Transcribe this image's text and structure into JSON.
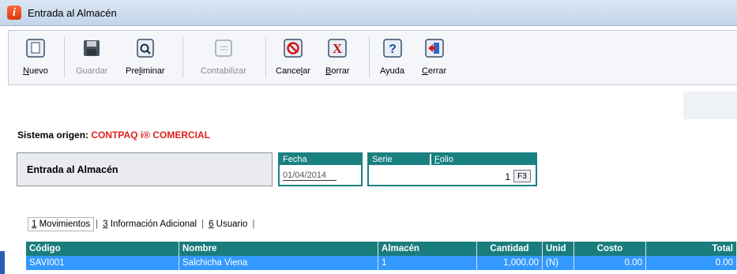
{
  "window": {
    "title": "Entrada al Almacén",
    "app_icon_glyph": "i"
  },
  "toolbar": {
    "nuevo": {
      "pre": "",
      "key": "N",
      "post": "uevo",
      "icon": "new-document-icon"
    },
    "guardar": {
      "label": "Guardar",
      "icon": "save-icon"
    },
    "preliminar": {
      "pre": "Pre",
      "key": "l",
      "post": "iminar",
      "icon": "print-preview-icon"
    },
    "contabilizar": {
      "label": "Contabilizar",
      "icon": "accounting-icon"
    },
    "cancelar": {
      "pre": "Cance",
      "key": "l",
      "post": "ar",
      "icon": "cancel-icon"
    },
    "borrar": {
      "pre": "",
      "key": "B",
      "post": "orrar",
      "icon": "delete-icon"
    },
    "ayuda": {
      "label": "Ayuda",
      "icon": "help-icon"
    },
    "cerrar": {
      "pre": "",
      "key": "C",
      "post": "errar",
      "icon": "close-door-icon"
    }
  },
  "origin": {
    "label": "Sistema origen:",
    "value": "CONTPAQ i® COMERCIAL"
  },
  "document": {
    "type": "Entrada al Almacén"
  },
  "fecha": {
    "label": "Fecha",
    "value": "01/04/2014"
  },
  "serie": {
    "label": "Serie",
    "value": ""
  },
  "folio": {
    "key": "F",
    "label_rest": "olio",
    "value": "1",
    "lookup_key": "F3"
  },
  "tabs": [
    {
      "num": "1",
      "label": " Movimientos"
    },
    {
      "num": "3",
      "label": " Información Adicional"
    },
    {
      "num": "6",
      "label": " Usuario"
    }
  ],
  "grid": {
    "columns": [
      "Código",
      "Nombre",
      "Almacén",
      "Cantidad",
      "Unid",
      "Costo",
      "Total"
    ],
    "rows": [
      {
        "codigo": "SAVI001",
        "nombre": "Salchicha Viena",
        "almacen": "1",
        "cantidad": "1,000.00",
        "unidad": "(N)",
        "costo": "0.00",
        "total": "0.00"
      }
    ]
  },
  "colors": {
    "header_teal": "#1a7d7d",
    "selection_blue": "#3399ff",
    "origin_red": "#e02020"
  }
}
